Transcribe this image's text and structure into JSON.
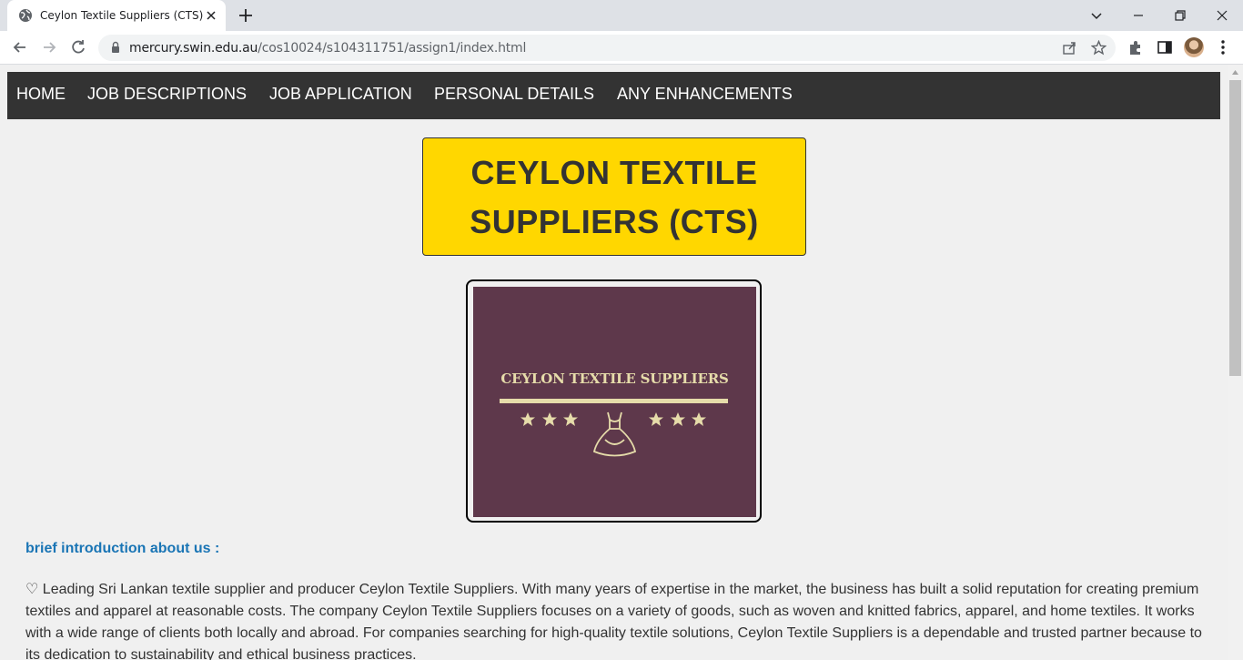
{
  "browser": {
    "tab": {
      "title": "Ceylon Textile Suppliers (CTS)",
      "favicon": "globe-icon"
    },
    "address": {
      "host": "mercury.swin.edu.au",
      "path": "/cos10024/s104311751/assign1/index.html"
    }
  },
  "nav": {
    "items": [
      {
        "label": "HOME"
      },
      {
        "label": "JOB DESCRIPTIONS"
      },
      {
        "label": "JOB APPLICATION"
      },
      {
        "label": "PERSONAL DETAILS"
      },
      {
        "label": "ANY ENHANCEMENTS"
      }
    ]
  },
  "header": {
    "title_line1": "CEYLON TEXTILE",
    "title_line2": "SUPPLIERS (CTS)"
  },
  "logo": {
    "text": "CEYLON TEXTILE SUPPLIERS",
    "background": "#5e384b",
    "accent": "#e6dcaa"
  },
  "intro": {
    "heading": "brief introduction about us :",
    "paragraph": "♡ Leading Sri Lankan textile supplier and producer Ceylon Textile Suppliers. With many years of expertise in the market, the business has built a solid reputation for creating premium textiles and apparel at reasonable costs. The company Ceylon Textile Suppliers focuses on a variety of goods, such as woven and knitted fabrics, apparel, and home textiles. It works with a wide range of clients both locally and abroad. For companies searching for high-quality textile solutions, Ceylon Textile Suppliers is a dependable and trusted partner because to its dedication to sustainability and ethical business practices."
  },
  "colors": {
    "nav_bg": "#333333",
    "title_bg": "#ffd700",
    "heading_blue": "#1a75b5"
  }
}
